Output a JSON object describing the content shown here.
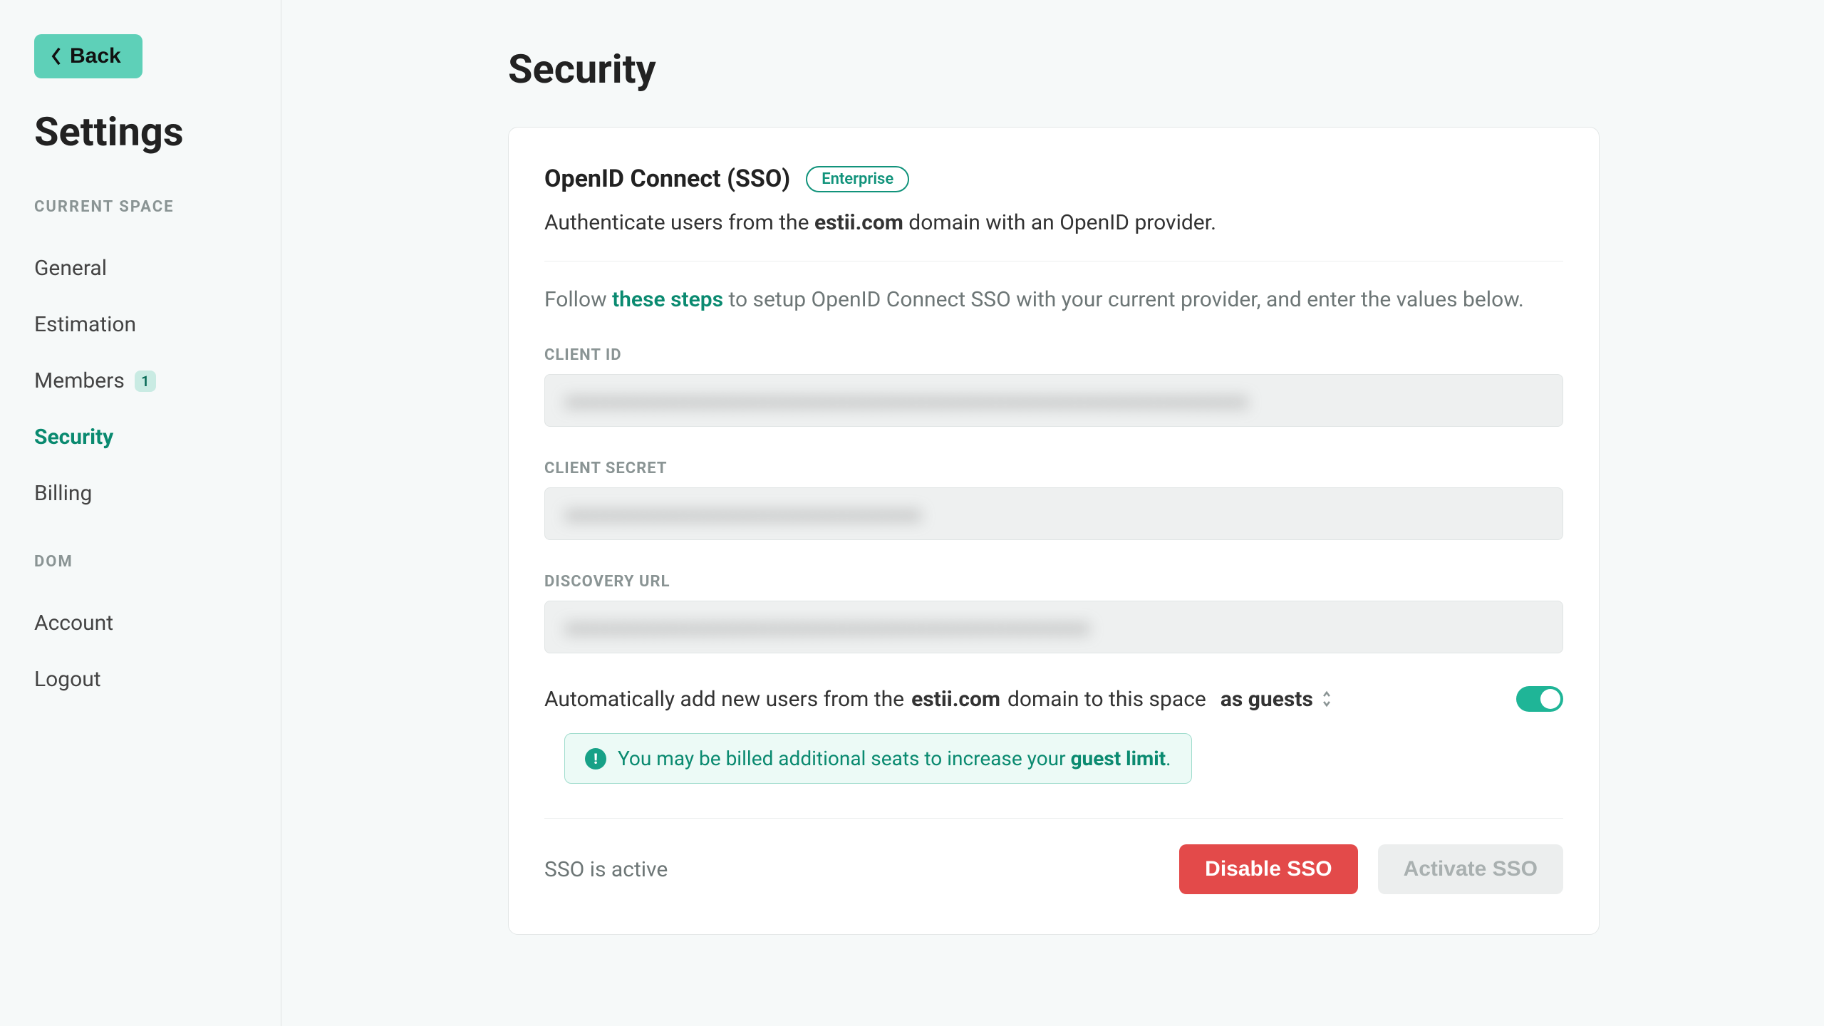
{
  "sidebar": {
    "back_label": "Back",
    "title": "Settings",
    "section_current": "CURRENT SPACE",
    "section_user": "DOM",
    "items_current": [
      {
        "label": "General"
      },
      {
        "label": "Estimation"
      },
      {
        "label": "Members",
        "badge": "1"
      },
      {
        "label": "Security",
        "active": true
      },
      {
        "label": "Billing"
      }
    ],
    "items_user": [
      {
        "label": "Account"
      },
      {
        "label": "Logout"
      }
    ]
  },
  "page": {
    "title": "Security"
  },
  "sso": {
    "title": "OpenID Connect (SSO)",
    "pill": "Enterprise",
    "sub_pre": "Authenticate users from the ",
    "domain": "estii.com",
    "sub_post": " domain with an OpenID provider.",
    "follow_pre": "Follow ",
    "follow_link": "these steps",
    "follow_post": " to setup OpenID Connect SSO with your current provider, and enter the values below.",
    "fields": {
      "client_id_label": "CLIENT ID",
      "client_secret_label": "CLIENT SECRET",
      "discovery_url_label": "DISCOVERY URL"
    },
    "auto_pre": "Automatically add new users from the ",
    "auto_domain": "estii.com",
    "auto_post": " domain to this space",
    "role": "as guests",
    "info_pre": "You may be billed additional seats to increase your ",
    "info_bold": "guest limit",
    "info_post": ".",
    "status": "SSO is active",
    "disable_label": "Disable SSO",
    "activate_label": "Activate SSO"
  }
}
